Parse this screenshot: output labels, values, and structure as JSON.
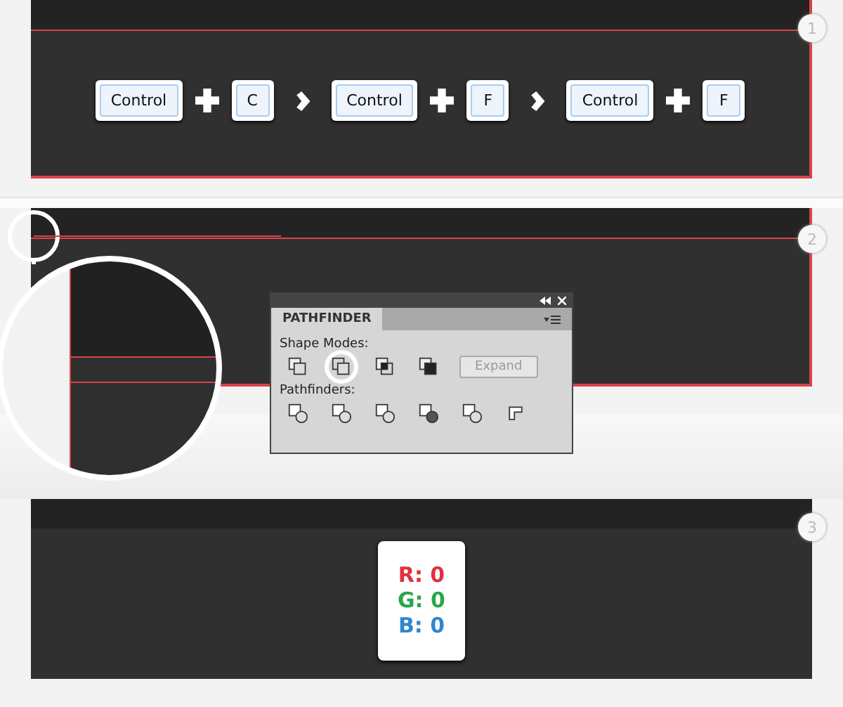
{
  "steps": [
    {
      "number": "1",
      "keys": [
        {
          "kind": "key",
          "label": "Control"
        },
        {
          "kind": "plus"
        },
        {
          "kind": "key",
          "label": "C"
        },
        {
          "kind": "arrow"
        },
        {
          "kind": "key",
          "label": "Control"
        },
        {
          "kind": "plus"
        },
        {
          "kind": "key",
          "label": "F"
        },
        {
          "kind": "arrow"
        },
        {
          "kind": "key",
          "label": "Control"
        },
        {
          "kind": "plus"
        },
        {
          "kind": "key",
          "label": "F"
        }
      ]
    },
    {
      "number": "2",
      "pathfinder": {
        "title": "PATHFINDER",
        "shape_modes_label": "Shape Modes:",
        "shape_modes": [
          {
            "kind": "unite",
            "highlighted": false
          },
          {
            "kind": "minus-front",
            "highlighted": true
          },
          {
            "kind": "intersect",
            "highlighted": false
          },
          {
            "kind": "exclude",
            "highlighted": false
          }
        ],
        "expand": {
          "label": "Expand",
          "disabled": true
        },
        "pathfinders_label": "Pathfinders:",
        "pathfinders": [
          {
            "kind": "divide"
          },
          {
            "kind": "trim"
          },
          {
            "kind": "merge"
          },
          {
            "kind": "crop"
          },
          {
            "kind": "outline"
          },
          {
            "kind": "minus-back"
          }
        ]
      }
    },
    {
      "number": "3",
      "color_values": [
        {
          "label": "R: 0",
          "color": "#e0313c"
        },
        {
          "label": "G: 0",
          "color": "#2aa64a"
        },
        {
          "label": "B: 0",
          "color": "#2f86d0"
        }
      ]
    }
  ]
}
